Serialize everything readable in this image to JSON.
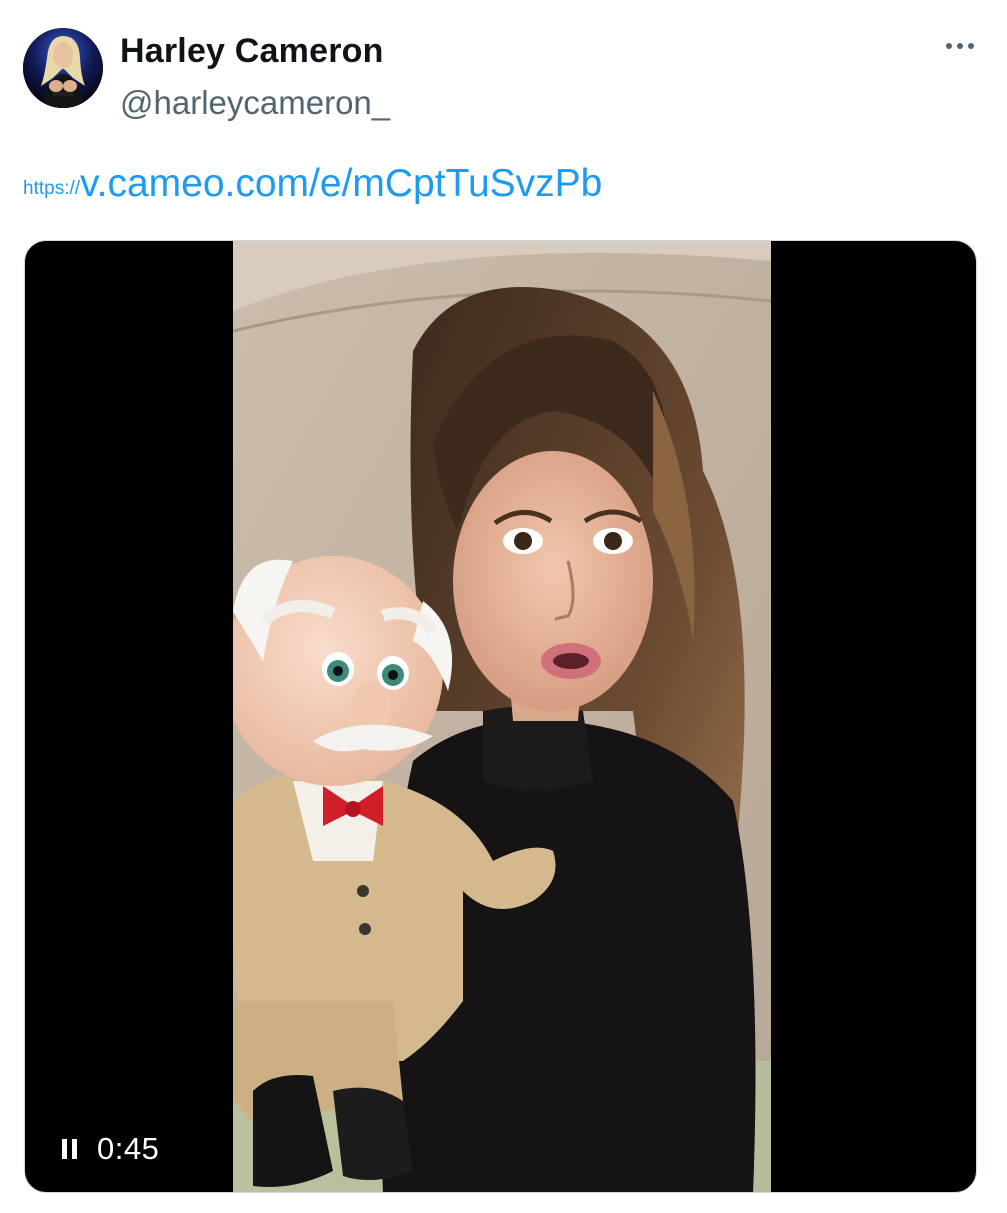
{
  "author": {
    "display_name": "Harley Cameron",
    "handle": "@harleycameron_",
    "avatar_icon": "profile-photo"
  },
  "more_menu": {
    "icon": "more-horizontal-icon"
  },
  "tweet": {
    "link_protocol": "https://",
    "link_rest": "v.cameo.com/e/mCptTuSvzPb"
  },
  "video": {
    "state": "playing",
    "control_icon": "pause-icon",
    "timestamp": "0:45"
  },
  "colors": {
    "link": "#1d9bf0",
    "handle": "#536471",
    "text": "#0f1419",
    "media_bg": "#000000"
  }
}
